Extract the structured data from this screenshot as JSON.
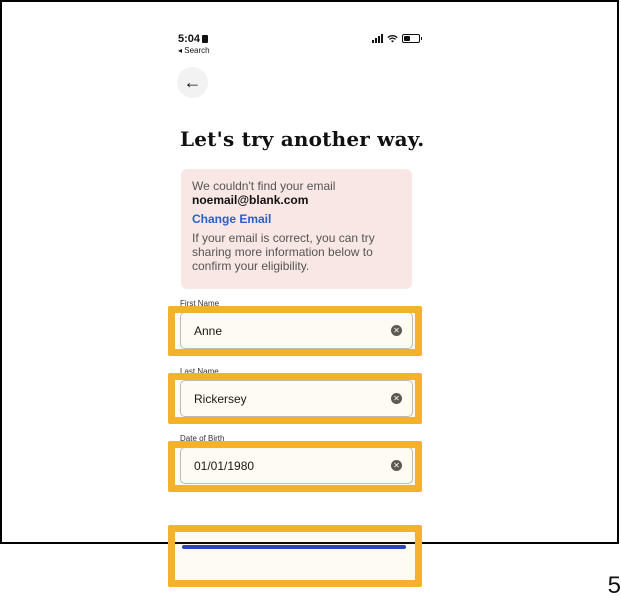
{
  "status_bar": {
    "time": "5:04",
    "back_label": "◂ Search",
    "battery_level": 0.35
  },
  "header": {
    "back_icon": "arrow-left-icon",
    "back_glyph": "←",
    "title": "Let's try another way."
  },
  "notice": {
    "line1": "We couldn't find your email",
    "email": "noemail@blank.com",
    "change_email": "Change Email",
    "help": "If your email is correct, you can try sharing more information below to confirm your eligibility."
  },
  "form": {
    "first_name": {
      "label": "First Name",
      "value": "Anne",
      "clear_glyph": "✕"
    },
    "last_name": {
      "label": "Last Name",
      "value": "Rickersey",
      "clear_glyph": "✕"
    },
    "dob": {
      "label": "Date of Birth",
      "value": "01/01/1980",
      "clear_glyph": "✕"
    }
  },
  "highlight_color": "#f4b12c",
  "page_number_fragment": "5"
}
